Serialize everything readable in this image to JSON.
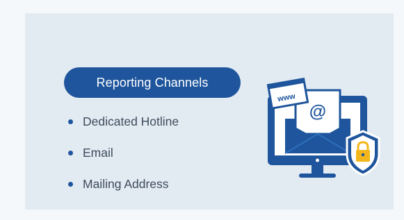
{
  "header": {
    "title": "Reporting Channels"
  },
  "channels": [
    {
      "label": "Dedicated Hotline"
    },
    {
      "label": "Email"
    },
    {
      "label": "Mailing Address"
    }
  ],
  "illustration": {
    "web_label": "www",
    "email_symbol": "@",
    "icons": [
      "monitor-icon",
      "envelope-icon",
      "at-sign-icon",
      "browser-window-icon",
      "shield-lock-icon"
    ]
  },
  "colors": {
    "page_background": "#f5f8fb",
    "card_background": "#e3ebf2",
    "accent": "#1e559c",
    "text": "#3d4b5c",
    "lock": "#f3b71c"
  }
}
